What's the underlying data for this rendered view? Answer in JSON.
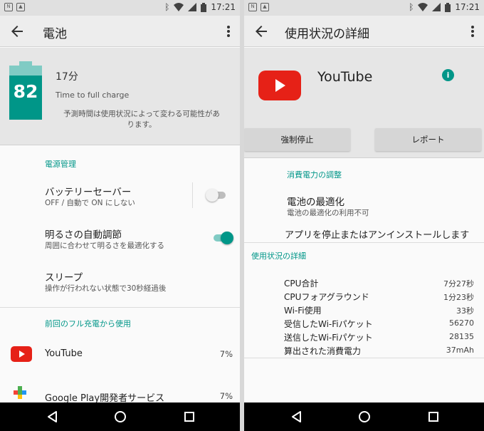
{
  "status_bar": {
    "time": "17:21"
  },
  "left": {
    "title": "電池",
    "battery_level": "82",
    "battery_fraction": 0.82,
    "charge_time": "17分",
    "charge_label": "Time to full charge",
    "charge_note": "予測時間は使用状況によって変わる可能性があります。",
    "power_section": "電源管理",
    "battery_saver": {
      "title": "バッテリーセーバー",
      "subtitle": "OFF / 自動で ON にしない",
      "enabled": false
    },
    "adaptive_brightness": {
      "title": "明るさの自動調節",
      "subtitle": "周囲に合わせて明るさを最適化する",
      "enabled": true
    },
    "sleep": {
      "title": "スリープ",
      "subtitle": "操作が行われない状態で30秒経過後"
    },
    "usage_section": "前回のフル充電から使用",
    "apps": [
      {
        "name": "YouTube",
        "percent": "7%",
        "icon": "youtube-icon"
      },
      {
        "name": "Google Play開発者サービス",
        "percent": "7%",
        "icon": "google-play-services-icon"
      }
    ]
  },
  "right": {
    "title": "使用状況の詳細",
    "app_name": "YouTube",
    "force_stop": "強制停止",
    "report": "レポート",
    "power_adjust_section": "消費電力の調整",
    "battery_optimization": {
      "title": "電池の最適化",
      "subtitle": "電池の最適化の利用不可"
    },
    "uninstall": "アプリを停止またはアンインストールします",
    "usage_detail_section": "使用状況の詳細",
    "stats": [
      {
        "label": "CPU合計",
        "value": "7分27秒"
      },
      {
        "label": "CPUフォアグラウンド",
        "value": "1分23秒"
      },
      {
        "label": "Wi-Fi使用",
        "value": "33秒"
      },
      {
        "label": "受信したWi-Fiパケット",
        "value": "56270"
      },
      {
        "label": "送信したWi-Fiパケット",
        "value": "28135"
      },
      {
        "label": "算出された消費電力",
        "value": "37mAh"
      }
    ]
  },
  "colors": {
    "accent": "#009688",
    "youtube_red": "#e62117"
  }
}
